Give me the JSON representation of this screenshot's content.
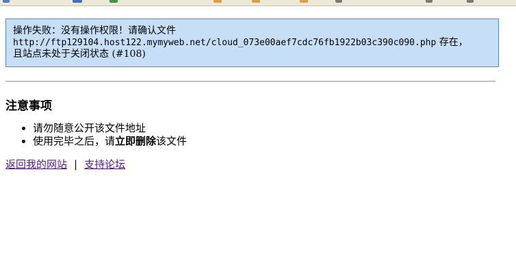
{
  "error": {
    "line1": "操作失败：没有操作权限！请确认文件",
    "url": "http://ftp129104.host122.mymyweb.net/cloud_073e00aef7cdc76fb1922b03c390c090.php",
    "line2_suffix": " 存在，",
    "line3": "且站点未处于关闭状态 (#108)"
  },
  "notes": {
    "title": "注意事项",
    "items": [
      {
        "text": "请勿随意公开该文件地址"
      },
      {
        "prefix": "使用完毕之后，请",
        "bold": "立即删除",
        "suffix": "该文件"
      }
    ]
  },
  "links": {
    "back": "返回我的网站",
    "separator": "|",
    "forum": "支持论坛"
  },
  "colors": {
    "error_background": "#c6dff7",
    "error_border": "#5a86b8",
    "visited_link": "#551a8b"
  }
}
